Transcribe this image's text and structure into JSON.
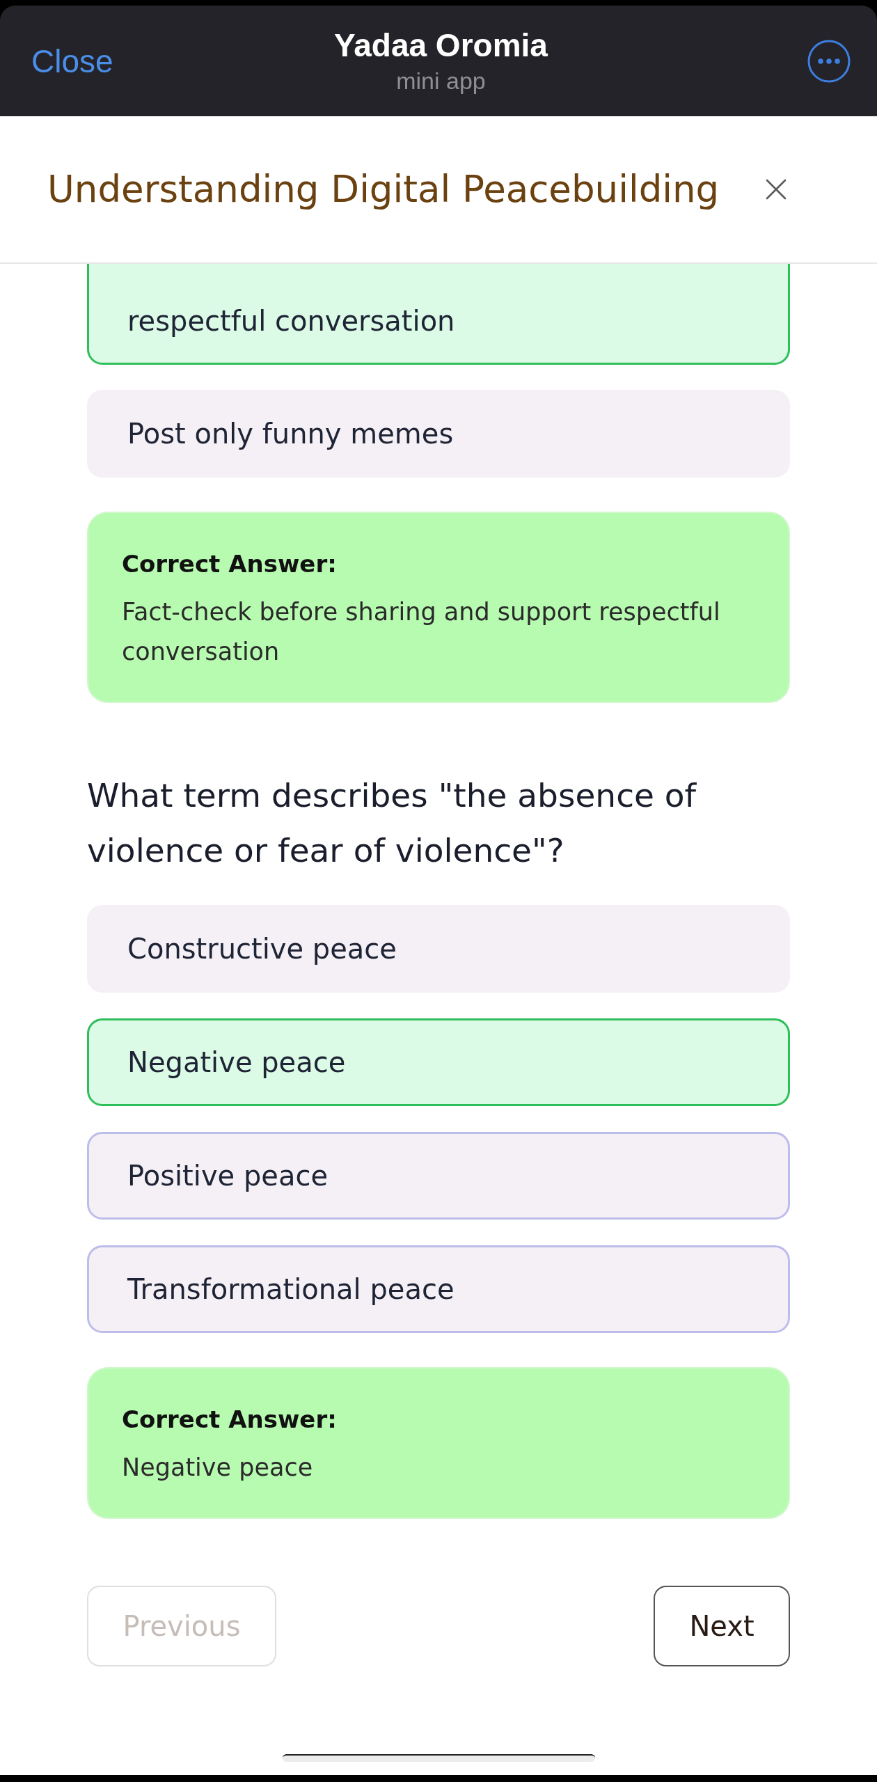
{
  "nav_bar": {
    "close": "Close",
    "title": "Yadaa Oromia",
    "subtitle": "mini app"
  },
  "modal": {
    "title": "Understanding Digital Peacebuilding"
  },
  "questions": [
    {
      "options": [
        {
          "text": "respectful conversation",
          "selected": true,
          "outlined": false
        },
        {
          "text": "Post only funny memes",
          "selected": false,
          "outlined": false
        }
      ],
      "answer": {
        "label": "Correct Answer:",
        "text": "Fact-check before sharing and support respectful conversation"
      }
    },
    {
      "question": "What term describes \"the absence of violence or fear of violence\"?",
      "options": [
        {
          "text": "Constructive peace",
          "selected": false,
          "outlined": false
        },
        {
          "text": "Negative peace",
          "selected": true,
          "outlined": false
        },
        {
          "text": "Positive peace",
          "selected": false,
          "outlined": true
        },
        {
          "text": "Transformational peace",
          "selected": false,
          "outlined": true
        }
      ],
      "answer": {
        "label": "Correct Answer:",
        "text": "Negative peace"
      }
    }
  ],
  "footer": {
    "previous": {
      "label": "Previous",
      "disabled": true
    },
    "next": {
      "label": "Next",
      "disabled": false
    }
  }
}
